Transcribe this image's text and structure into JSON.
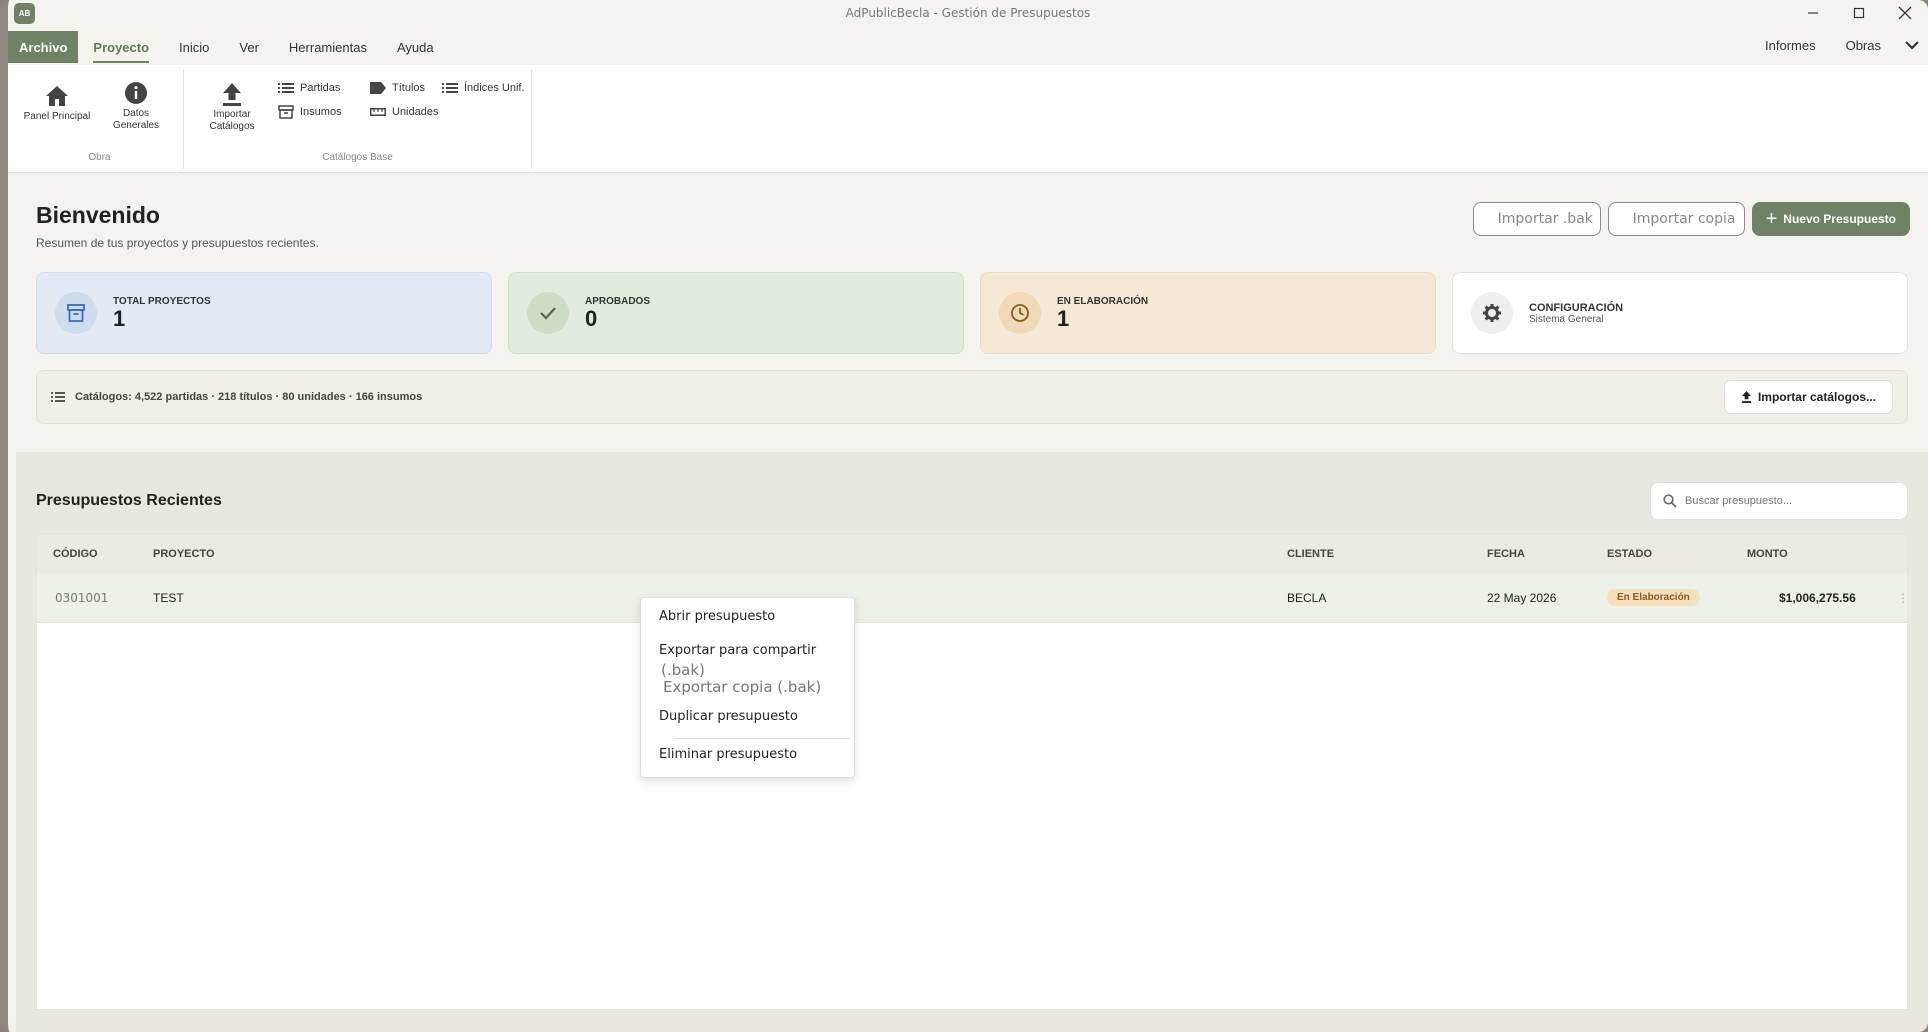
{
  "window": {
    "title": "AdPublicBecla - Gestión de Presupuestos",
    "logo": "AB"
  },
  "menu": {
    "archivo": "Archivo",
    "items": [
      "Proyecto",
      "Inicio",
      "Ver",
      "Herramientas",
      "Ayuda"
    ],
    "right": [
      "Informes",
      "Obras"
    ]
  },
  "ribbon": {
    "obra": {
      "label": "Obra",
      "panel": "Panel Principal",
      "datos": "Datos Generales"
    },
    "catalogos": {
      "label": "Catálogos Base",
      "importar": "Importar Catálogos",
      "partidas": "Partidas",
      "titulos": "Títulos",
      "indices": "Índices Unif.",
      "insumos": "Insumos",
      "unidades": "Unidades"
    }
  },
  "welcome": {
    "title": "Bienvenido",
    "subtitle": "Resumen de tus proyectos y presupuestos recientes."
  },
  "actions": {
    "import_bak": "Importar .bak",
    "import_copy": "Importar copia",
    "new": "Nuevo Presupuesto"
  },
  "cards": [
    {
      "label": "TOTAL PROYECTOS",
      "value": "1"
    },
    {
      "label": "APROBADOS",
      "value": "0"
    },
    {
      "label": "EN ELABORACIÓN",
      "value": "1"
    },
    {
      "label": "CONFIGURACIÓN",
      "sub": "Sistema General"
    }
  ],
  "catalog_bar": {
    "text": "Catálogos: 4,522 partidas · 218 títulos · 80 unidades · 166 insumos",
    "button": "Importar catálogos..."
  },
  "recent": {
    "title": "Presupuestos Recientes",
    "search_placeholder": "Buscar presupuesto..."
  },
  "table": {
    "headers": {
      "codigo": "CÓDIGO",
      "proyecto": "PROYECTO",
      "cliente": "CLIENTE",
      "fecha": "FECHA",
      "estado": "ESTADO",
      "monto": "MONTO"
    },
    "rows": [
      {
        "codigo": "0301001",
        "proyecto": "TEST",
        "cliente": "BECLA",
        "fecha": "22 May 2026",
        "estado": "En Elaboración",
        "monto": "$1,006,275.56"
      }
    ]
  },
  "context_menu": {
    "open": "Abrir presupuesto",
    "export_share": "Exportar para compartir",
    "export_share_ext": "(.bak)",
    "export_copy": "Exportar copia (.bak)",
    "duplicate": "Duplicar presupuesto",
    "delete": "Eliminar presupuesto"
  }
}
